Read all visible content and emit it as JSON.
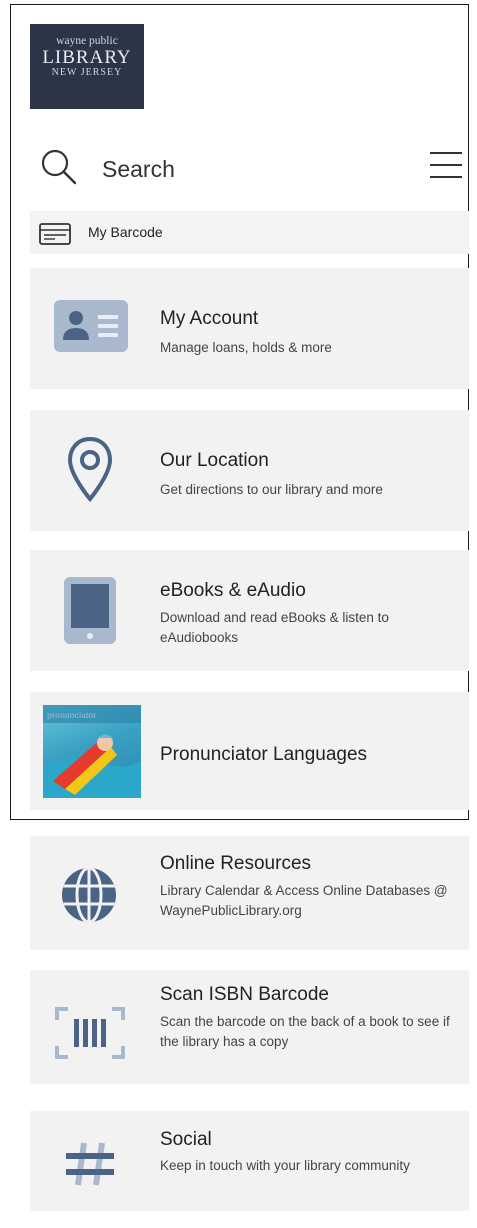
{
  "header": {
    "logo": {
      "line1": "wayne public",
      "line2": "LIBRARY",
      "line3": "NEW JERSEY"
    },
    "search_label": "Search"
  },
  "barcode": {
    "label": "My Barcode"
  },
  "cards": [
    {
      "title": "My Account",
      "subtitle": "Manage loans, holds & more",
      "icon": "id-card-icon"
    },
    {
      "title": "Our Location",
      "subtitle": "Get directions to our library and more",
      "icon": "map-pin-icon"
    },
    {
      "title": "eBooks & eAudio",
      "subtitle": "Download and read eBooks & listen to eAudiobooks",
      "icon": "tablet-icon"
    },
    {
      "title": "Pronunciator Languages",
      "subtitle": "",
      "icon": "pronunciator-thumbnail",
      "thumb_text": "pronunciator"
    },
    {
      "title": "Online Resources",
      "subtitle": "Library Calendar & Access Online Databases @ WaynePublicLibrary.org",
      "icon": "globe-icon"
    },
    {
      "title": "Scan ISBN Barcode",
      "subtitle": "Scan the barcode on the back of a book to see if the library has a copy",
      "icon": "barcode-scan-icon"
    },
    {
      "title": "Social",
      "subtitle": "Keep in touch with your library community",
      "icon": "hashtag-icon"
    }
  ],
  "colors": {
    "icon": "#4b6486",
    "icon_light": "#a9b9cd",
    "card_bg": "#f2f2f2"
  }
}
